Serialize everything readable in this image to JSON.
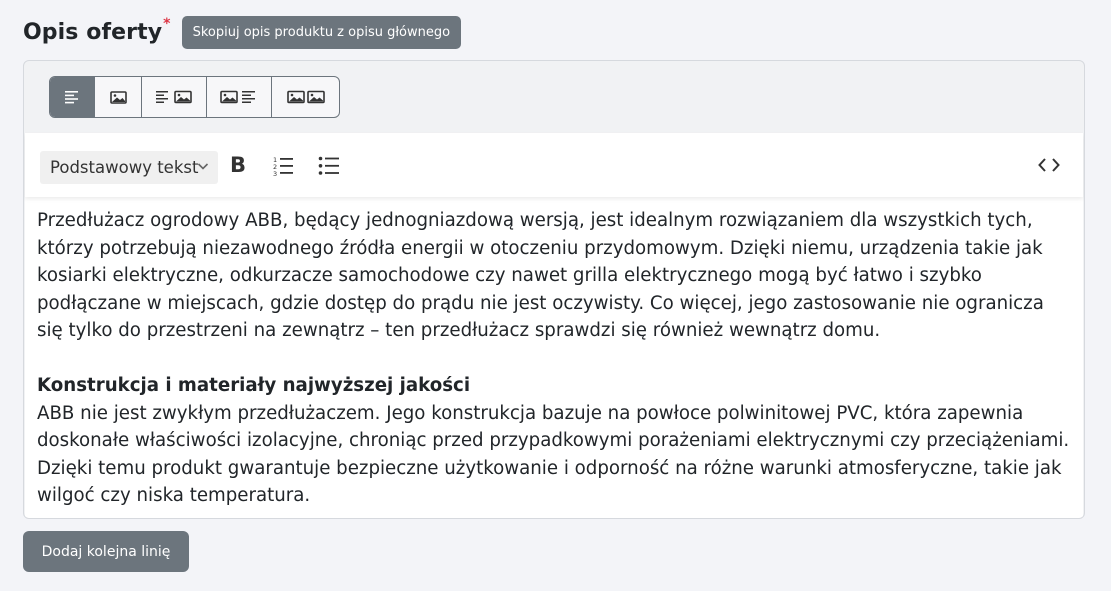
{
  "section": {
    "title": "Opis oferty",
    "required_mark": "*",
    "copy_button_label": "Skopiuj opis produktu z opisu głównego"
  },
  "layout_options": {
    "icons": [
      "text-only-icon",
      "image-only-icon",
      "text-image-icon",
      "image-text-icon",
      "image-image-icon"
    ],
    "selected": "text-only"
  },
  "toolbar": {
    "style_select_value": "Podstawowy tekst",
    "bold_label": "B"
  },
  "content": {
    "paragraph1": "Przedłużacz ogrodowy ABB, będący jednogniazdową wersją, jest idealnym rozwiązaniem dla wszystkich tych, którzy potrzebują niezawodnego źródła energii w otoczeniu przydomowym. Dzięki niemu, urządzenia takie jak kosiarki elektryczne, odkurzacze samochodowe czy nawet grilla elektrycznego mogą być łatwo i szybko podłączane w miejscach, gdzie dostęp do prądu nie jest oczywisty. Co więcej, jego zastosowanie nie ogranicza się tylko do przestrzeni na zewnątrz – ten przedłużacz sprawdzi się również wewnątrz domu.",
    "heading2": "Konstrukcja i materiały najwyższej jakości",
    "paragraph2": "ABB nie jest zwykłym przedłużaczem. Jego konstrukcja bazuje na powłoce polwinitowej PVC, która zapewnia doskonałe właściwości izolacyjne, chroniąc przed przypadkowymi porażeniami elektrycznymi czy przeciążeniami. Dzięki temu produkt gwarantuje bezpieczne użytkowanie i odporność na różne warunki atmosferyczne, takie jak wilgoć czy niska temperatura."
  },
  "add_line_button_label": "Dodaj kolejna linię",
  "colors": {
    "button_bg": "#6c757d",
    "required": "#dc3545",
    "page_bg": "#f3f4f8"
  }
}
